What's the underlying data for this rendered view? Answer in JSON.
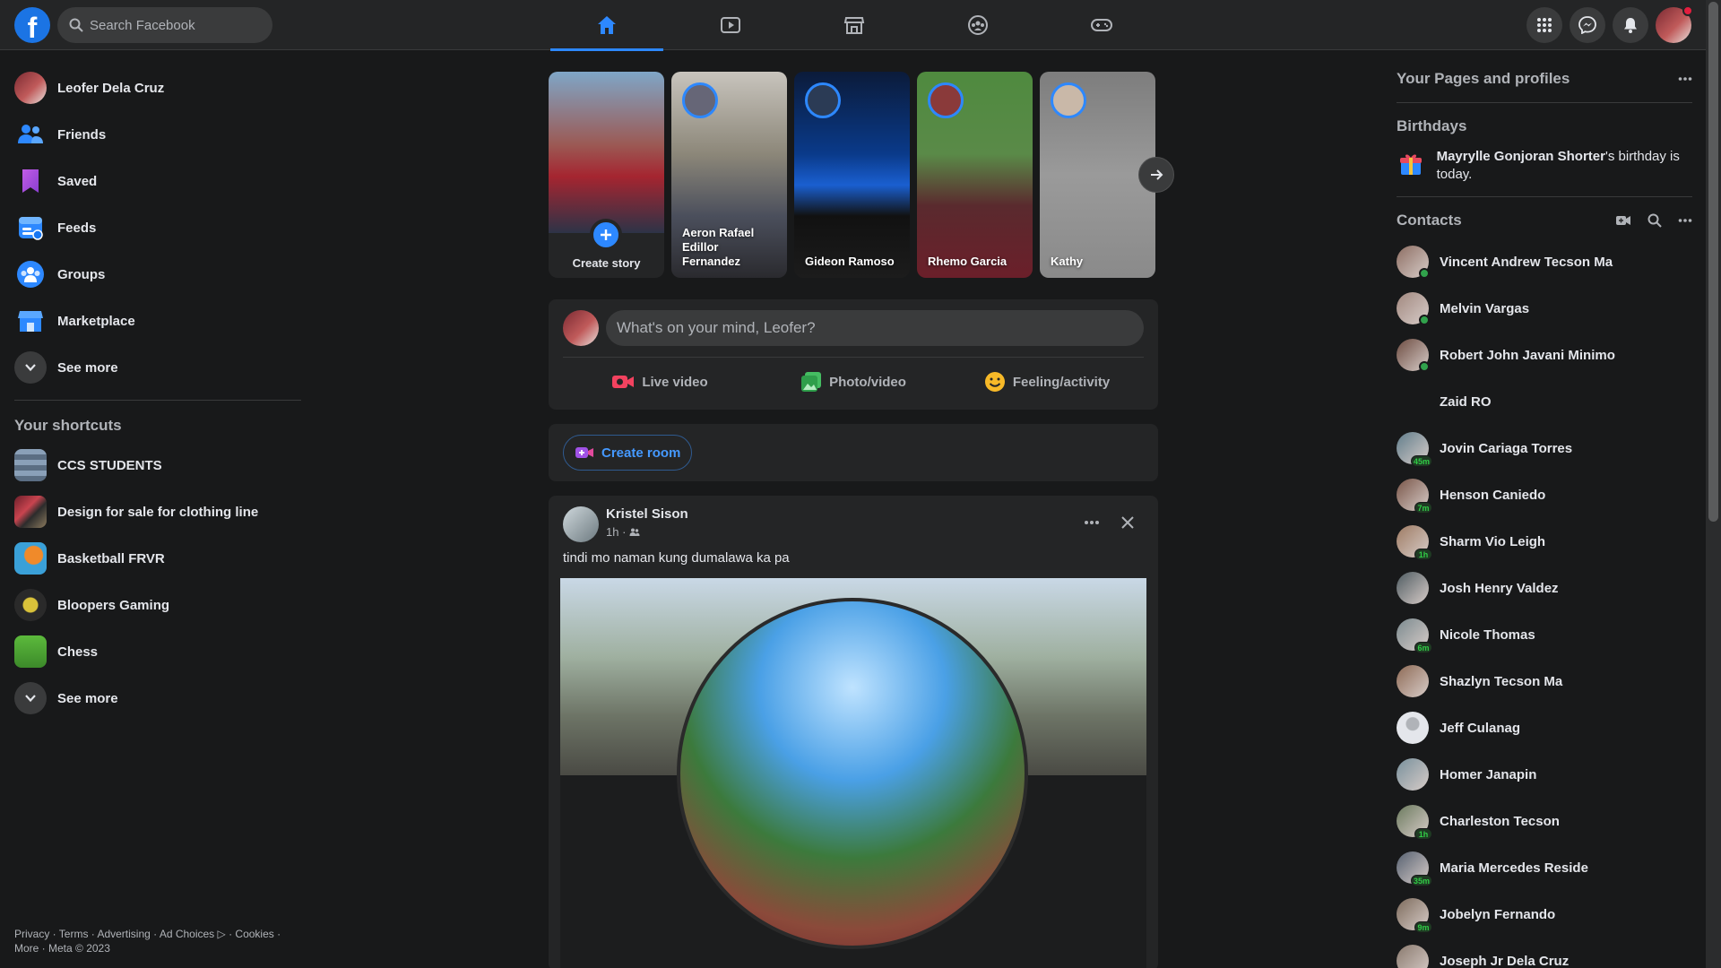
{
  "topbar": {
    "logo": "f",
    "search_placeholder": "Search Facebook",
    "tabs": [
      {
        "name": "home-icon",
        "active": true
      },
      {
        "name": "watch-icon",
        "active": false
      },
      {
        "name": "marketplace-icon",
        "active": false
      },
      {
        "name": "groups-icon",
        "active": false
      },
      {
        "name": "gaming-icon",
        "active": false
      }
    ],
    "right": [
      "menu-grid-icon",
      "messenger-icon",
      "notifications-icon"
    ]
  },
  "left_nav": {
    "items": [
      {
        "label": "Leofer Dela Cruz",
        "icon": "profile-avatar"
      },
      {
        "label": "Friends",
        "icon": "friends-icon"
      },
      {
        "label": "Saved",
        "icon": "saved-icon"
      },
      {
        "label": "Feeds",
        "icon": "feeds-icon"
      },
      {
        "label": "Groups",
        "icon": "groups-icon"
      },
      {
        "label": "Marketplace",
        "icon": "marketplace-icon"
      },
      {
        "label": "See more",
        "icon": "chevron-down-icon"
      }
    ],
    "shortcuts_title": "Your shortcuts",
    "shortcuts": [
      {
        "label": "CCS STUDENTS"
      },
      {
        "label": "Design for sale for clothing line"
      },
      {
        "label": "Basketball FRVR"
      },
      {
        "label": "Bloopers Gaming"
      },
      {
        "label": "Chess"
      },
      {
        "label": "See more"
      }
    ],
    "footer": {
      "line1": "Privacy · Terms · Advertising · Ad Choices ▷ · Cookies ·",
      "line2": "More · Meta © 2023"
    }
  },
  "stories": {
    "create_label": "Create story",
    "items": [
      {
        "name": "Aeron Rafael Edillor Fernandez"
      },
      {
        "name": "Gideon Ramoso"
      },
      {
        "name": "Rhemo Garcia"
      },
      {
        "name": "Kathy"
      }
    ]
  },
  "composer": {
    "placeholder": "What's on your mind, Leofer?",
    "actions": [
      {
        "label": "Live video",
        "color": "#f3425f"
      },
      {
        "label": "Photo/video",
        "color": "#45bd62"
      },
      {
        "label": "Feeling/activity",
        "color": "#f7b928"
      }
    ]
  },
  "room": {
    "label": "Create room"
  },
  "post": {
    "author": "Kristel Sison",
    "time": "1h ·",
    "text": "tindi mo naman kung dumalawa ka pa"
  },
  "right_col": {
    "pages_title": "Your Pages and profiles",
    "birthdays_title": "Birthdays",
    "birthday_name": "Mayrylle Gonjoran Shorter",
    "birthday_rest": "'s birthday is today.",
    "contacts_title": "Contacts",
    "contacts": [
      {
        "name": "Vincent Andrew Tecson Ma",
        "status": "online",
        "badge": ""
      },
      {
        "name": "Melvin Vargas",
        "status": "online",
        "badge": ""
      },
      {
        "name": "Robert John Javani Minimo",
        "status": "online",
        "badge": ""
      },
      {
        "name": "Zaid RO",
        "status": "none",
        "badge": ""
      },
      {
        "name": "Jovin Cariaga Torres",
        "status": "away",
        "badge": "45m"
      },
      {
        "name": "Henson Caniedo",
        "status": "away",
        "badge": "7m"
      },
      {
        "name": "Sharm Vio Leigh",
        "status": "away",
        "badge": "1h"
      },
      {
        "name": "Josh Henry Valdez",
        "status": "none",
        "badge": ""
      },
      {
        "name": "Nicole Thomas",
        "status": "away",
        "badge": "6m"
      },
      {
        "name": "Shazlyn Tecson Ma",
        "status": "none",
        "badge": ""
      },
      {
        "name": "Jeff Culanag",
        "status": "none",
        "badge": ""
      },
      {
        "name": "Homer Janapin",
        "status": "none",
        "badge": ""
      },
      {
        "name": "Charleston Tecson",
        "status": "away",
        "badge": "1h"
      },
      {
        "name": "Maria Mercedes Reside",
        "status": "away",
        "badge": "35m"
      },
      {
        "name": "Jobelyn Fernando",
        "status": "away",
        "badge": "9m"
      },
      {
        "name": "Joseph Jr Dela Cruz",
        "status": "none",
        "badge": ""
      }
    ]
  }
}
